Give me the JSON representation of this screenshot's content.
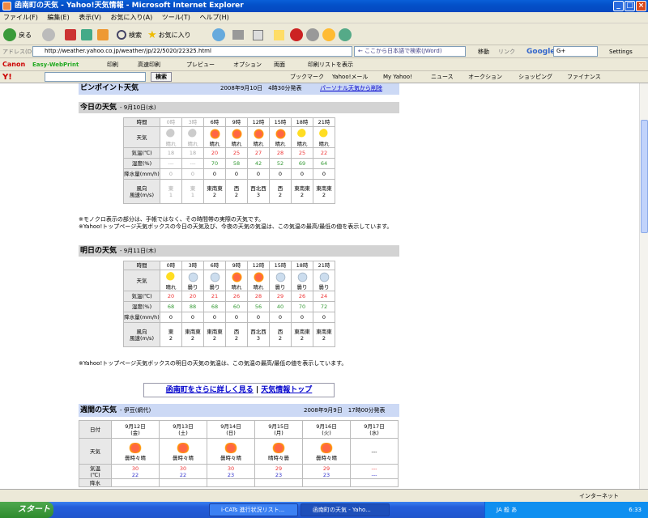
{
  "window": {
    "title": "函南町の天気 - Yahoo!天気情報 - Microsoft Internet Explorer",
    "min": "_",
    "max": "□",
    "close": "×"
  },
  "menu": [
    "ファイル(F)",
    "編集(E)",
    "表示(V)",
    "お気に入り(A)",
    "ツール(T)",
    "ヘルプ(H)"
  ],
  "nav": {
    "back": "戻る",
    "search": "検索",
    "favorites": "お気に入り"
  },
  "address": {
    "label": "アドレス(D)",
    "url": "http://weather.yahoo.co.jp/weather/jp/22/5020/22325.html",
    "ime": "← ここから日本語で検索(JWord)",
    "go": "移動",
    "links": "リンク",
    "google": "Google",
    "g": "G+",
    "settings": "Settings"
  },
  "canon": {
    "logo": "Canon",
    "easy": "Easy-WebPrint",
    "print": "印刷",
    "fast": "高速印刷",
    "preview": "プレビュー",
    "option": "オプション",
    "both": "両面",
    "list": "印刷リストを表示"
  },
  "yahoo": {
    "logo": "Y!",
    "search": "検索",
    "bookmark": "ブックマーク",
    "mail": "Yahoo!メール",
    "my": "My Yahoo!",
    "news": "ニュース",
    "auction": "オークション",
    "shopping": "ショッピング",
    "finance": "ファイナンス"
  },
  "pinpoint": {
    "title": "ピンポイント天気",
    "time": "2008年9月10日　4時30分発表",
    "link": "パーソナル天気から削除"
  },
  "today": {
    "title": "今日の天気",
    "date": "- 9月10日(水)",
    "row_labels": [
      "時間",
      "天気",
      "気温(℃)",
      "湿度(%)",
      "降水量(mm/h)",
      "風向\n風速(m/s)"
    ],
    "hours": [
      "0時",
      "3時",
      "6時",
      "9時",
      "12時",
      "15時",
      "18時",
      "21時"
    ],
    "weather": [
      "晴れ",
      "晴れ",
      "晴れ",
      "晴れ",
      "晴れ",
      "晴れ",
      "晴れ",
      "晴れ"
    ],
    "icons": [
      "moongray",
      "moongray",
      "sun",
      "sun",
      "sun",
      "sun",
      "moon",
      "moon"
    ],
    "temp": [
      "18",
      "18",
      "20",
      "25",
      "27",
      "28",
      "25",
      "22"
    ],
    "humid": [
      "---",
      "---",
      "70",
      "58",
      "42",
      "52",
      "69",
      "64"
    ],
    "rain": [
      "0",
      "0",
      "0",
      "0",
      "0",
      "0",
      "0",
      "0"
    ],
    "wind_dir": [
      "東",
      "東",
      "東南東",
      "西",
      "西北西",
      "西",
      "東南東",
      "東南東"
    ],
    "wind_spd": [
      "1",
      "1",
      "2",
      "2",
      "3",
      "2",
      "2",
      "2"
    ],
    "gray_cols": 2
  },
  "today_notes": [
    "※モノクロ表示の部分は、手帳ではなく、その時間帯の実際の天気です。",
    "※Yahoo!トップページ天気ボックスの今日の天気及び、今夜の天気の気温は、この気温の最高/最低の値を表示しています。"
  ],
  "tomorrow": {
    "title": "明日の天気",
    "date": "- 9月11日(木)",
    "row_labels": [
      "時間",
      "天気",
      "気温(℃)",
      "湿度(%)",
      "降水量(mm/h)",
      "風向\n風速(m/s)"
    ],
    "hours": [
      "0時",
      "3時",
      "6時",
      "9時",
      "12時",
      "15時",
      "18時",
      "21時"
    ],
    "weather": [
      "晴れ",
      "曇り",
      "曇り",
      "晴れ",
      "晴れ",
      "曇り",
      "曇り",
      "曇り"
    ],
    "icons": [
      "moon",
      "cloud",
      "cloud",
      "sun",
      "sun",
      "cloud",
      "cloud",
      "cloud"
    ],
    "temp": [
      "20",
      "20",
      "21",
      "26",
      "28",
      "29",
      "26",
      "24"
    ],
    "humid": [
      "68",
      "88",
      "68",
      "60",
      "56",
      "40",
      "70",
      "72"
    ],
    "rain": [
      "0",
      "0",
      "0",
      "0",
      "0",
      "0",
      "0",
      "0"
    ],
    "wind_dir": [
      "東",
      "東南東",
      "東南東",
      "西",
      "西北西",
      "西",
      "東南東",
      "東南東"
    ],
    "wind_spd": [
      "2",
      "2",
      "2",
      "2",
      "3",
      "2",
      "2",
      "2"
    ],
    "gray_cols": 0
  },
  "tomorrow_notes": [
    "※Yahoo!トップページ天気ボックスの明日の天気の気温は、この気温の最高/最低の値を表示しています。"
  ],
  "links": {
    "detail": "函南町をさらに詳しく見る",
    "sep": "|",
    "top": "天気情報トップ"
  },
  "weekly": {
    "title": "週間の天気",
    "region": "- 伊豆(網代)",
    "time": "2008年9月9日　17時00分発表",
    "row_labels": [
      "日付",
      "天気",
      "気温\n(℃)",
      "降水"
    ],
    "dates": [
      "9月12日\n(金)",
      "9月13日\n(土)",
      "9月14日\n(日)",
      "9月15日\n(月)",
      "9月16日\n(火)",
      "9月17日\n(水)"
    ],
    "weather": [
      "曇時々晴",
      "曇時々晴",
      "曇時々晴",
      "晴時々曇",
      "曇時々晴",
      "---"
    ],
    "high": [
      "30",
      "30",
      "30",
      "29",
      "29",
      "---"
    ],
    "low": [
      "22",
      "22",
      "23",
      "23",
      "23",
      "---"
    ]
  },
  "status": {
    "text": "",
    "zone": "インターネット"
  },
  "taskbar": {
    "start": "スタート",
    "task1": "i-CATs 進行状況リスト...",
    "task2": "函南町の天気 - Yaho...",
    "clock": "6:33",
    "ime": "JA 般 あ"
  }
}
